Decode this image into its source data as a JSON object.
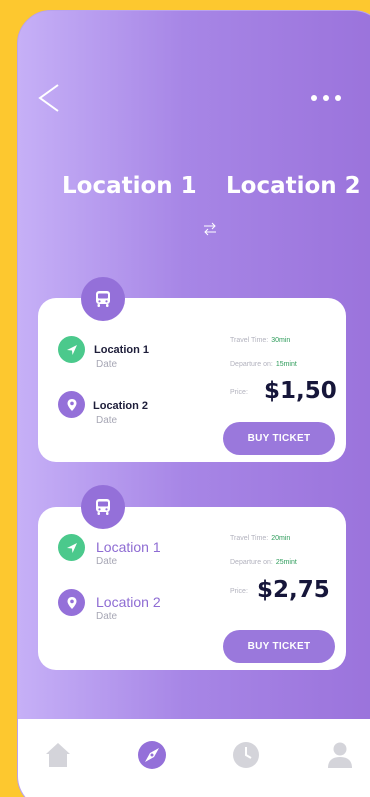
{
  "route": {
    "from": "Location 1",
    "to": "Location 2"
  },
  "trips": [
    {
      "origin": "Location 1",
      "origin_date": "Date",
      "destination": "Location 2",
      "destination_date": "Date",
      "travel_time_label": "Travel Time:",
      "travel_time": "30min",
      "departure_label": "Departure on:",
      "departure": "15mint",
      "price_label": "Price:",
      "price": "$1,50",
      "button": "BUY TICKET"
    },
    {
      "origin": "Location 1",
      "origin_date": "Date",
      "destination": "Location 2",
      "destination_date": "Date",
      "travel_time_label": "Travel Time:",
      "travel_time": "20min",
      "departure_label": "Departure on:",
      "departure": "25mint",
      "price_label": "Price:",
      "price": "$2,75",
      "button": "BUY TICKET"
    }
  ],
  "tabbar": {
    "active": "explore",
    "icons": [
      "home-icon",
      "compass-icon",
      "clock-icon",
      "profile-icon"
    ]
  },
  "colors": {
    "accent": "#9470D9",
    "green": "#4BC98C",
    "background": "#FDC82F"
  }
}
